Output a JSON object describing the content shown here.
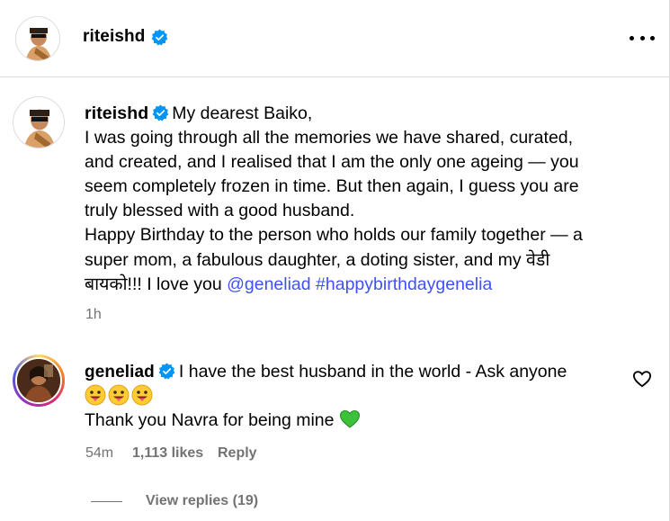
{
  "header": {
    "username": "riteishd",
    "verified_color": "#0095f6",
    "more_icon": "more-horizontal-icon"
  },
  "caption": {
    "username": "riteishd",
    "lines": [
      "My dearest Baiko,",
      "I was going through all the memories we have shared, curated,",
      "and created, and I realised that I am the only one ageing — you",
      "seem completely frozen in time. But then again, I guess you are",
      "truly blessed with a good husband.",
      "Happy Birthday to the person who holds our family together — a",
      "super mom, a fabulous daughter, a doting sister, and my वेडी",
      "बायको!!! I love you"
    ],
    "mention": "@geneliad",
    "hashtag": "#happybirthdaygenelia",
    "link_color": "#4150f7",
    "time": "1h"
  },
  "comment": {
    "username": "geneliad",
    "text": "I have the best husband in the world - Ask anyone",
    "emojis": [
      "tongue-out-emoji",
      "tongue-out-emoji",
      "tongue-out-emoji"
    ],
    "second_line": "Thank you Navra for being mine",
    "heart_emoji": "green-heart-emoji",
    "time": "54m",
    "likes": "1,113 likes",
    "reply_label": "Reply",
    "view_replies": "View replies (19)"
  }
}
